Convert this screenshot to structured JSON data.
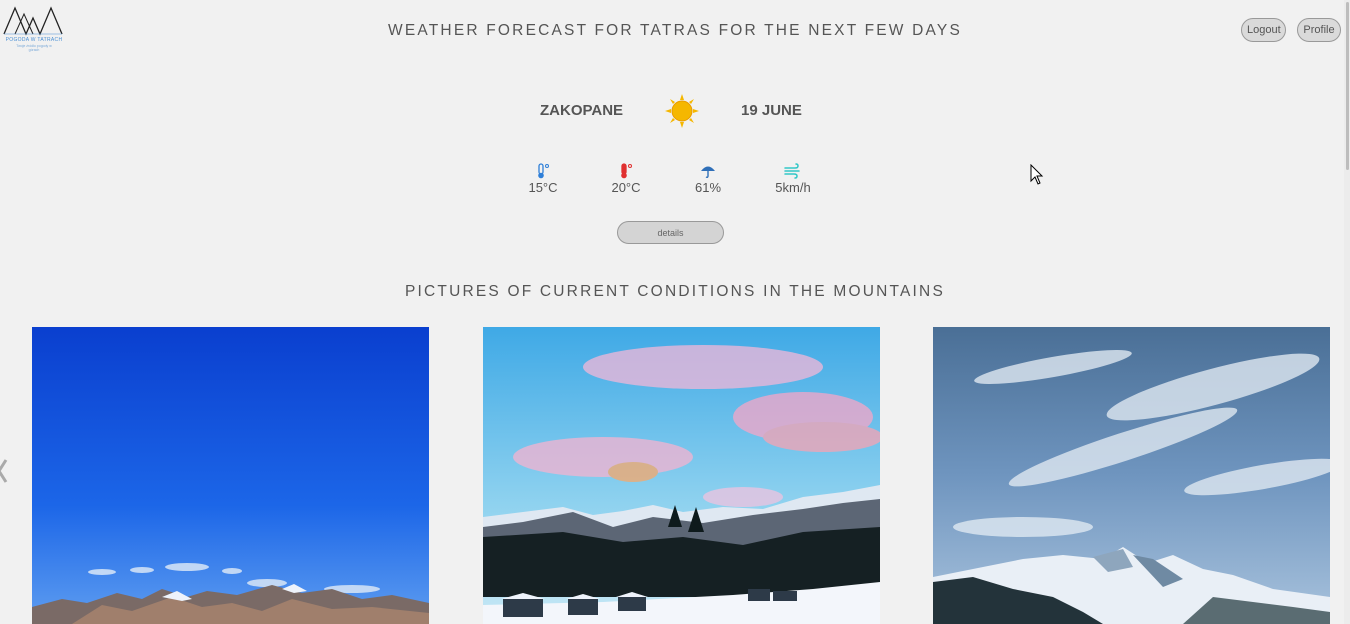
{
  "header": {
    "logo": {
      "icon": "mountains-logo-icon",
      "text": "POGODA W TATRACH",
      "subtext": "Twoje źródło pogody w górach"
    },
    "title": "WEATHER FORECAST FOR TATRAS FOR THE NEXT FEW DAYS",
    "logout_label": "Logout",
    "profile_label": "Profile"
  },
  "forecast": {
    "city": "ZAKOPANE",
    "weather_icon": "sun-icon",
    "date": "19 JUNE",
    "stats": [
      {
        "icon": "thermometer-cold-icon",
        "value": "15°C"
      },
      {
        "icon": "thermometer-hot-icon",
        "value": "20°C"
      },
      {
        "icon": "umbrella-icon",
        "value": "61%"
      },
      {
        "icon": "wind-icon",
        "value": "5km/h"
      }
    ],
    "details_label": "details"
  },
  "pictures": {
    "title": "PICTURES OF CURRENT CONDITIONS IN THE MOUNTAINS",
    "items": [
      {
        "name": "blue-sky-mountain-photo"
      },
      {
        "name": "pink-sunset-valley-photo"
      },
      {
        "name": "cloudy-snowy-peaks-photo"
      }
    ]
  },
  "colors": {
    "background": "#f1f1f1",
    "text": "#555555",
    "sun": "#f5b700",
    "cold": "#2f7fd8",
    "hot": "#e03030",
    "rain": "#2f6fb8",
    "wind": "#32c7c7"
  }
}
